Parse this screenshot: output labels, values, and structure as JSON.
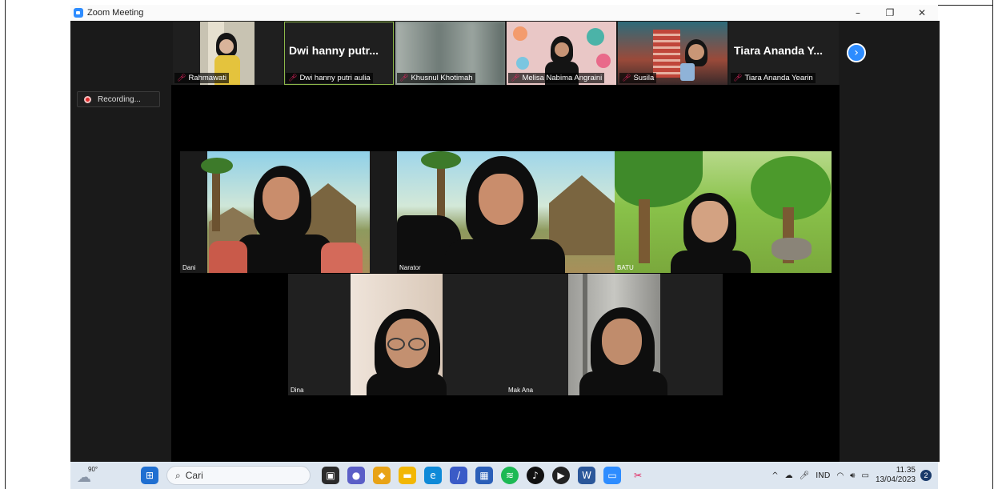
{
  "window": {
    "title": "Zoom Meeting",
    "minimize": "–",
    "restore": "❐",
    "close": "✕"
  },
  "gallery_strip": [
    {
      "name": "Rahmawati",
      "big_label": "",
      "muted": true,
      "active": false,
      "bg": "#b9b4a5"
    },
    {
      "name": "Dwi hanny putri aulia",
      "big_label": "Dwi hanny putr...",
      "muted": true,
      "active": true,
      "bg": "#1f1f1f"
    },
    {
      "name": "Khusnul Khotimah",
      "big_label": "",
      "muted": true,
      "active": false,
      "bg": "#7e8a86"
    },
    {
      "name": "Melisa Nabima Angraini",
      "big_label": "",
      "muted": true,
      "active": false,
      "bg": "#e9c7c6"
    },
    {
      "name": "Susila",
      "big_label": "",
      "muted": true,
      "active": false,
      "bg": "#3a5b6a"
    },
    {
      "name": "Tiara Ananda Yearin",
      "big_label": "Tiara Ananda Y...",
      "muted": true,
      "active": false,
      "bg": "#1f1f1f"
    }
  ],
  "next_page_icon": "chevron-right-icon",
  "recording": {
    "label": "Recording..."
  },
  "speakers": {
    "dani": "Dani",
    "narator": "Narator",
    "batu": "BATU",
    "dina": "Dina",
    "mak_ana": "Mak Ana"
  },
  "taskbar": {
    "weather": "90°",
    "search_placeholder": "Cari",
    "language": "IND",
    "time": "11.35",
    "date": "13/04/2023",
    "notification_count": "2"
  },
  "colors": {
    "zoom_blue": "#2d8cff",
    "recording_red": "#e02b2b",
    "active_border": "#8db84a"
  }
}
